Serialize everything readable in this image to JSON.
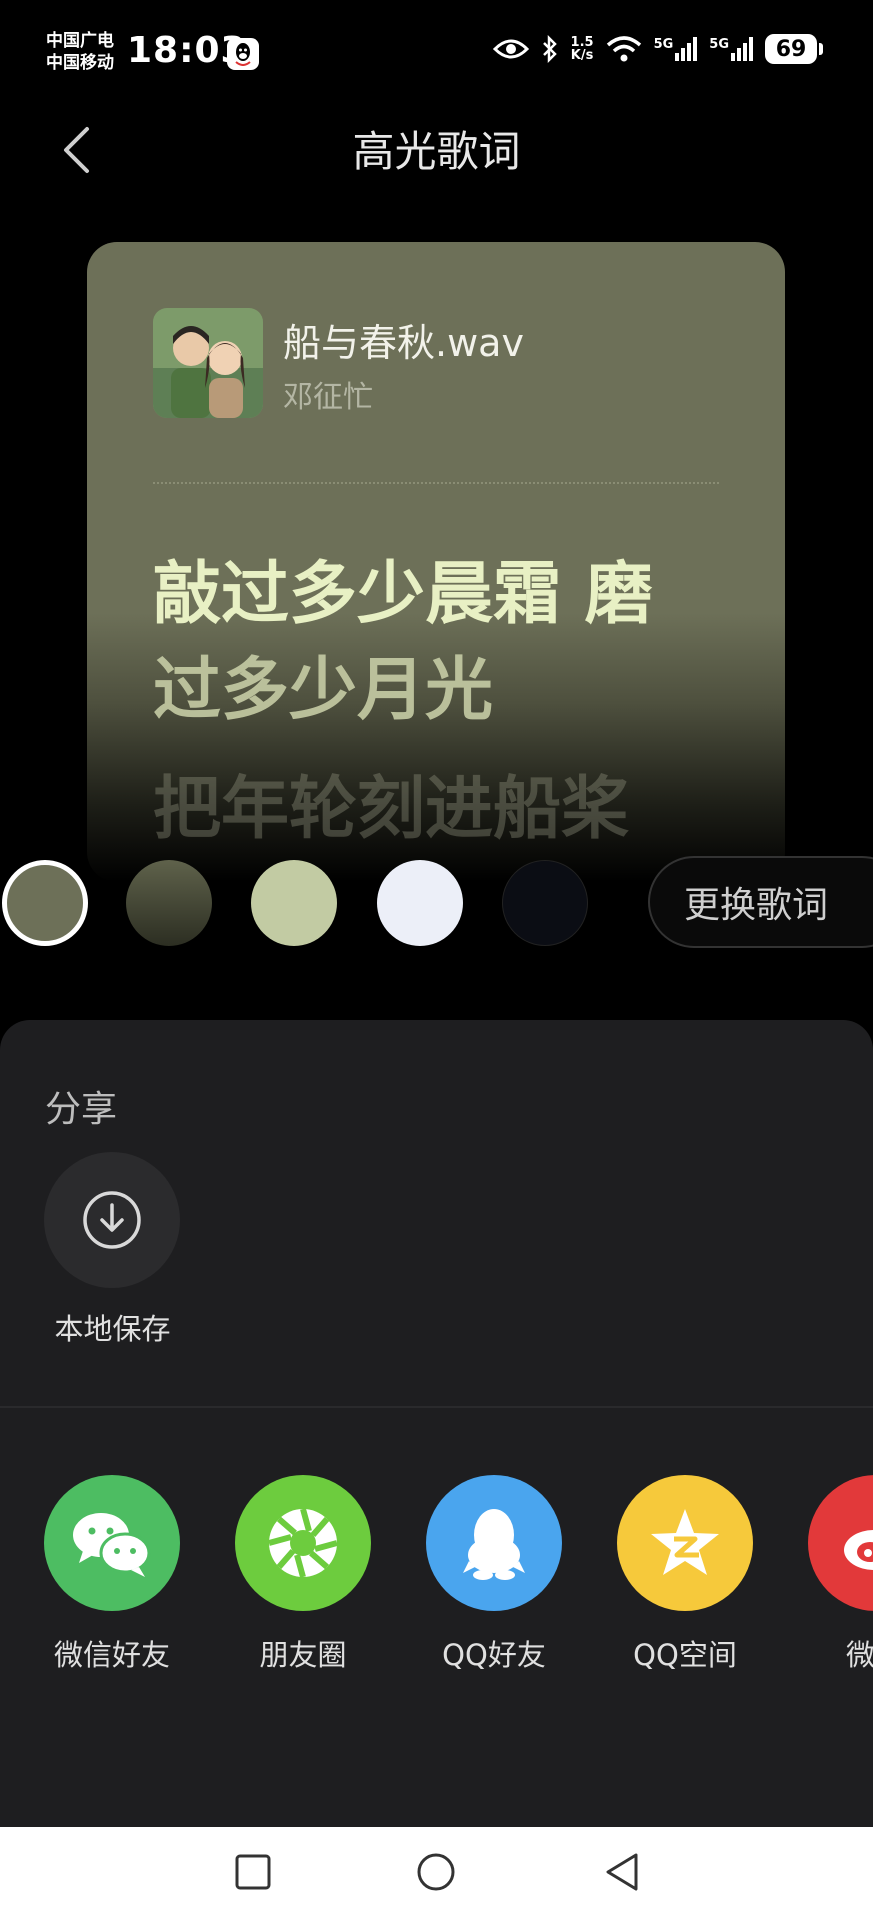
{
  "status_bar": {
    "carrier_line1": "中国广电",
    "carrier_line2": "中国移动",
    "time": "18:03",
    "speed_value": "1.5",
    "speed_unit": "K/s",
    "battery": "69",
    "network1": "5G",
    "network2": "5G"
  },
  "header": {
    "title": "高光歌词"
  },
  "card": {
    "song_title": "船与春秋.wav",
    "artist": "邓征忙",
    "lyric_line1": "敲过多少晨霜 磨",
    "lyric_line2": "过多少月光",
    "lyric_line3": "把年轮刻进船桨"
  },
  "swatches": [
    "#6d7058",
    "#4a4c3a",
    "#c2cba3",
    "#eceff8",
    "#0b0d14"
  ],
  "change_lyrics_label": "更换歌词",
  "share": {
    "section_label": "分享",
    "save_label": "本地保存",
    "apps": [
      {
        "label": "微信好友",
        "color": "#4dbd62"
      },
      {
        "label": "朋友圈",
        "color": "#6dcc3e"
      },
      {
        "label": "QQ好友",
        "color": "#4aa5ee"
      },
      {
        "label": "QQ空间",
        "color": "#f6c93b"
      },
      {
        "label": "微",
        "color": "#e2393a"
      }
    ]
  }
}
